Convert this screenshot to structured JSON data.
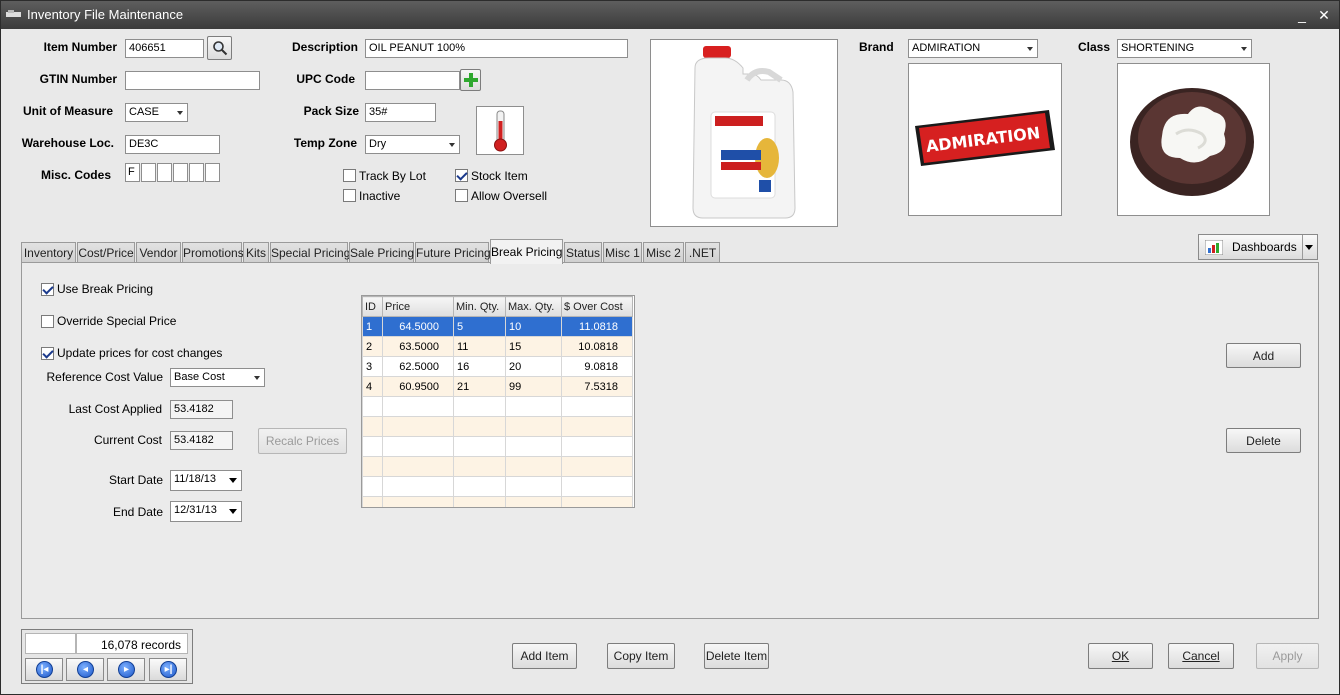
{
  "window": {
    "title": "Inventory File Maintenance",
    "minimize": "_",
    "close": "✕"
  },
  "form": {
    "item_number_label": "Item Number",
    "item_number": "406651",
    "gtin_label": "GTIN Number",
    "gtin": "",
    "uom_label": "Unit of Measure",
    "uom": "CASE",
    "warehouse_label": "Warehouse Loc.",
    "warehouse": "DE3C",
    "misc_label": "Misc. Codes",
    "misc_codes": [
      "F",
      "",
      "",
      "",
      "",
      ""
    ],
    "description_label": "Description",
    "description": "OIL PEANUT 100%",
    "upc_label": "UPC Code",
    "upc": "",
    "pack_size_label": "Pack Size",
    "pack_size": "35#",
    "temp_zone_label": "Temp Zone",
    "temp_zone": "Dry",
    "brand_label": "Brand",
    "brand": "ADMIRATION",
    "class_label": "Class",
    "class": "SHORTENING",
    "brand_logo_text": "ADMIRATION",
    "checks": {
      "track_by_lot": {
        "label": "Track By Lot",
        "checked": false
      },
      "stock_item": {
        "label": "Stock Item",
        "checked": true
      },
      "inactive": {
        "label": "Inactive",
        "checked": false
      },
      "allow_oversell": {
        "label": "Allow Oversell",
        "checked": false
      }
    }
  },
  "tabs": [
    "Inventory",
    "Cost/Price",
    "Vendor",
    "Promotions",
    "Kits",
    "Special Pricing",
    "Sale Pricing",
    "Future Pricing",
    "Break Pricing",
    "Status",
    "Misc 1",
    "Misc 2",
    ".NET"
  ],
  "active_tab": "Break Pricing",
  "dashboards_label": "Dashboards",
  "break_pricing": {
    "use_break_pricing": {
      "label": "Use Break Pricing",
      "checked": true
    },
    "override_special_price": {
      "label": "Override Special Price",
      "checked": false
    },
    "update_prices": {
      "label": "Update prices for cost changes",
      "checked": true
    },
    "reference_cost_label": "Reference Cost Value",
    "reference_cost": "Base Cost",
    "last_cost_label": "Last Cost Applied",
    "last_cost": "53.4182",
    "current_cost_label": "Current Cost",
    "current_cost": "53.4182",
    "recalc_label": "Recalc Prices",
    "start_date_label": "Start Date",
    "start_date": "11/18/13",
    "end_date_label": "End Date",
    "end_date": "12/31/13",
    "add_label": "Add",
    "delete_label": "Delete",
    "grid": {
      "columns": [
        "ID",
        "Price",
        "Min. Qty.",
        "Max. Qty.",
        "$ Over Cost"
      ],
      "rows": [
        [
          "1",
          "64.5000",
          "5",
          "10",
          "11.0818"
        ],
        [
          "2",
          "63.5000",
          "11",
          "15",
          "10.0818"
        ],
        [
          "3",
          "62.5000",
          "16",
          "20",
          "9.0818"
        ],
        [
          "4",
          "60.9500",
          "21",
          "99",
          "7.5318"
        ]
      ],
      "selected_row": 0
    }
  },
  "footer": {
    "records": "16,078 records",
    "add_item": "Add Item",
    "copy_item": "Copy Item",
    "delete_item": "Delete Item",
    "ok": "OK",
    "cancel": "Cancel",
    "apply": "Apply"
  }
}
